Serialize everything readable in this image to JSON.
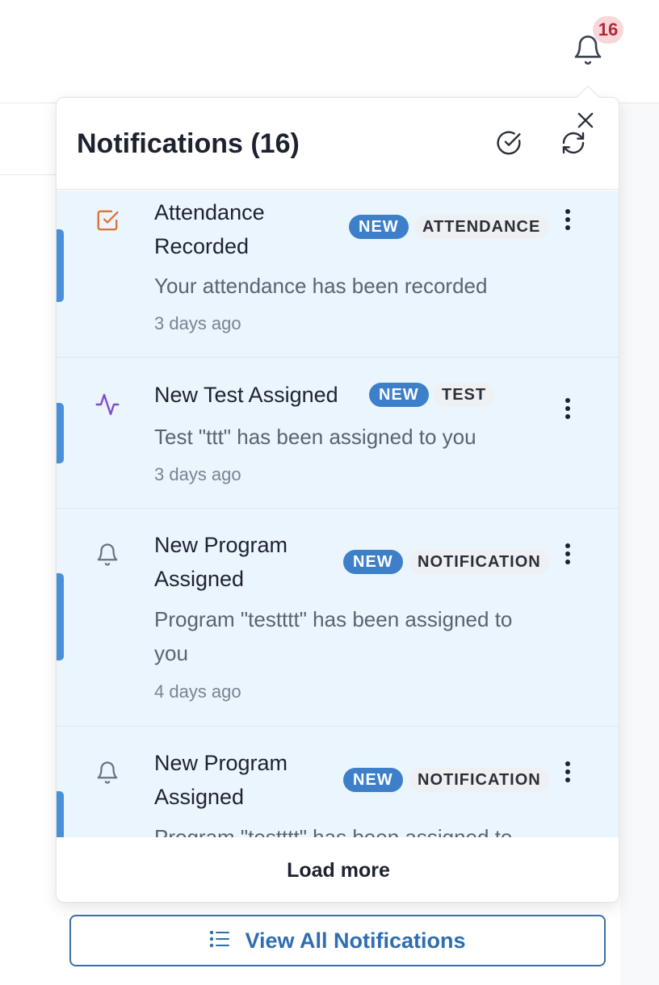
{
  "header": {
    "notification_count_badge": "16"
  },
  "panel": {
    "title": "Notifications (16)",
    "actions": {
      "mark_all_read_icon": "check-circle-icon",
      "refresh_icon": "refresh-icon",
      "close_icon": "close-icon"
    }
  },
  "notifications": [
    {
      "title": "Attendance Recorded",
      "icon": "checkbox-icon",
      "icon_color": "#e06c2c",
      "status_badge": "NEW",
      "category": "ATTENDANCE",
      "message": "Your attendance has been recorded",
      "time": "3 days ago"
    },
    {
      "title": "New Test Assigned",
      "icon": "activity-icon",
      "icon_color": "#7c4dcf",
      "status_badge": "NEW",
      "category": "TEST",
      "message": "Test \"ttt\" has been assigned to you",
      "time": "3 days ago"
    },
    {
      "title": "New Program Assigned",
      "icon": "bell-icon",
      "icon_color": "#6b7280",
      "status_badge": "NEW",
      "category": "NOTIFICATION",
      "message": "Program \"testttt\" has been assigned to you",
      "time": "4 days ago"
    },
    {
      "title": "New Program Assigned",
      "icon": "bell-icon",
      "icon_color": "#6b7280",
      "status_badge": "NEW",
      "category": "NOTIFICATION",
      "message": "Program \"testttt\" has been assigned to you",
      "time": ""
    }
  ],
  "load_more_label": "Load more",
  "view_all_label": "View All Notifications",
  "colors": {
    "accent": "#4a90d9",
    "new_badge": "#3d7fc9",
    "unread_bg": "#ebf5fd",
    "count_badge_bg": "#f8d7da",
    "count_badge_text": "#b02a37"
  }
}
